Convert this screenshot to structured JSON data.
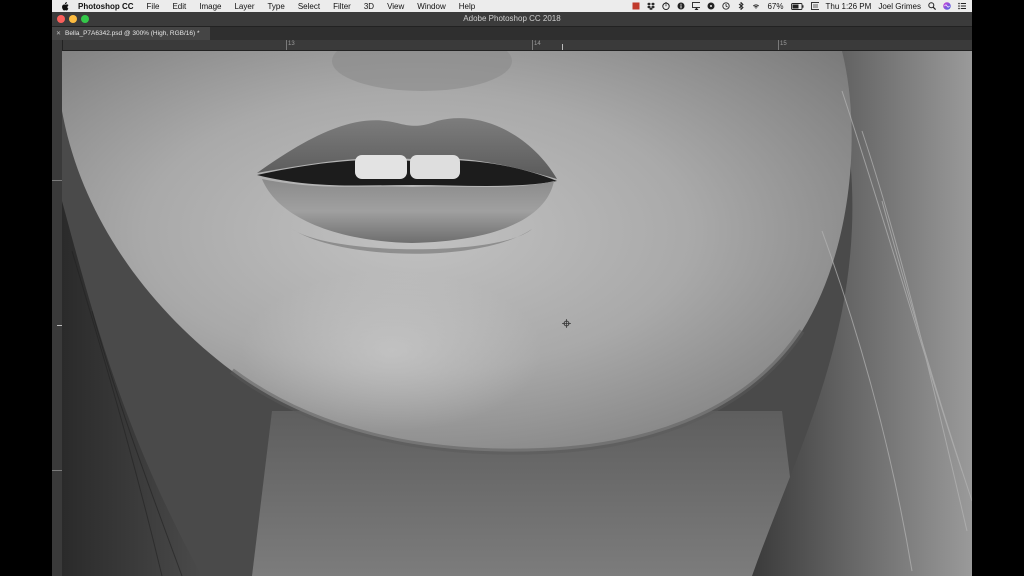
{
  "menubar": {
    "apple_icon": "apple-icon",
    "items": [
      "Photoshop CC",
      "File",
      "Edit",
      "Image",
      "Layer",
      "Type",
      "Select",
      "Filter",
      "3D",
      "View",
      "Window",
      "Help"
    ],
    "battery_percent": "67%",
    "clock": "Thu 1:26 PM",
    "user": "Joel Grimes",
    "status_icons": [
      "app-icon",
      "dropbox-icon",
      "timer-icon",
      "info-icon",
      "airplay-icon",
      "music-icon",
      "time-machine-icon",
      "bluetooth-icon",
      "wifi-icon",
      "battery-icon",
      "flag-icon",
      "search-icon",
      "siri-icon",
      "notification-center-icon"
    ]
  },
  "window": {
    "title": "Adobe Photoshop CC 2018"
  },
  "document_tab": {
    "label": "Bella_P7A6342.psd @ 300% (High, RGB/16) *"
  },
  "ruler": {
    "labels": [
      "13",
      "14",
      "15"
    ]
  },
  "colors": {
    "close": "#fc605c",
    "minimize": "#fdbc40",
    "maximize": "#34c84a",
    "ui_dark": "#2b2b2b",
    "menubar": "#ececec"
  }
}
